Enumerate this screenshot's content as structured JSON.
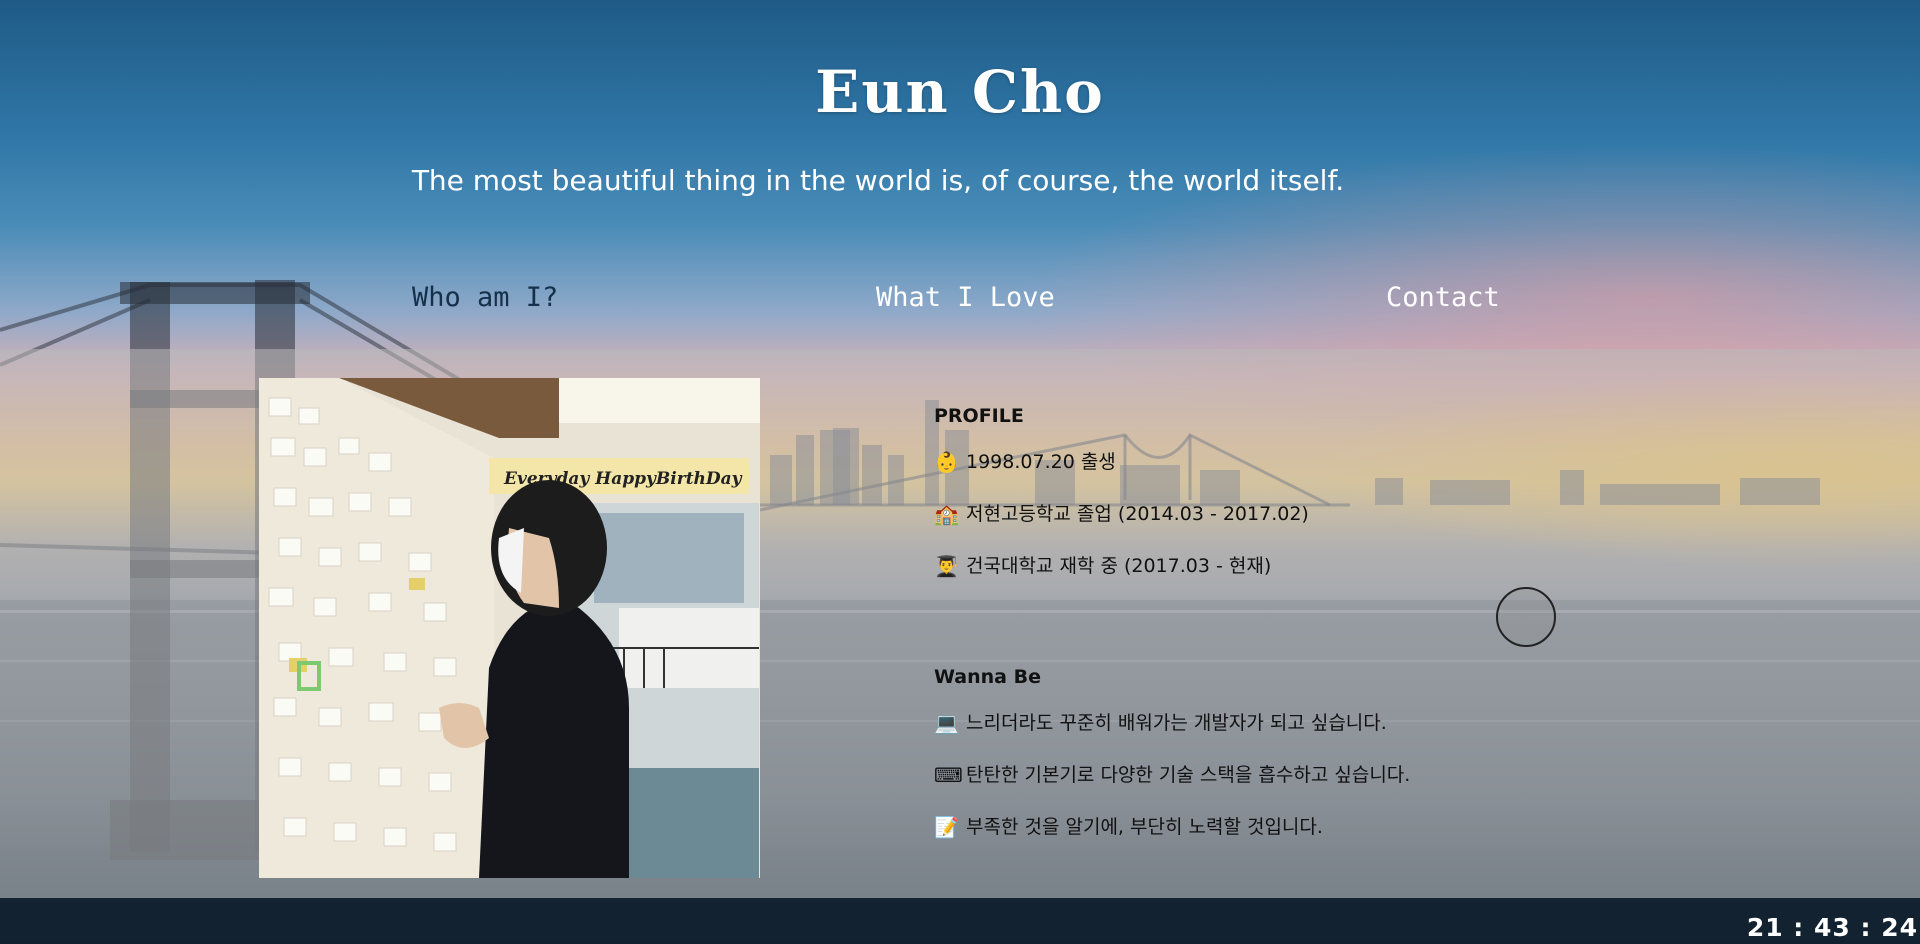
{
  "header": {
    "title": "Eun Cho",
    "tagline": "The most beautiful thing in the world is, of course, the world itself."
  },
  "nav": {
    "items": [
      {
        "label": "Who am I?"
      },
      {
        "label": "What I Love"
      },
      {
        "label": "Contact"
      }
    ]
  },
  "photo": {
    "sign_text": "Everyday HappyBirthDay"
  },
  "profile": {
    "title": "PROFILE",
    "items": [
      {
        "icon": "baby-icon",
        "glyph": "👶",
        "text": "1998.07.20 출생"
      },
      {
        "icon": "school-icon",
        "glyph": "🏫",
        "text": "저현고등학교 졸업 (2014.03 - 2017.02)"
      },
      {
        "icon": "graduate-icon",
        "glyph": "👨‍🎓",
        "text": "건국대학교 재학 중 (2017.03 - 현재)"
      }
    ]
  },
  "wanna_be": {
    "title": "Wanna Be",
    "items": [
      {
        "icon": "laptop-icon",
        "glyph": "💻",
        "text": "느리더라도 꾸준히 배워가는 개발자가 되고 싶습니다."
      },
      {
        "icon": "keyboard-icon",
        "glyph": "⌨",
        "text": "탄탄한 기본기로 다양한 기술 스택을 흡수하고 싶습니다."
      },
      {
        "icon": "memo-icon",
        "glyph": "📝",
        "text": "부족한 것을 알기에, 부단히 노력할 것입니다."
      }
    ]
  },
  "clock": {
    "time": "21 : 43 : 24"
  },
  "colors": {
    "nav_active": "#16304a",
    "panel": "#b9b9b9"
  }
}
